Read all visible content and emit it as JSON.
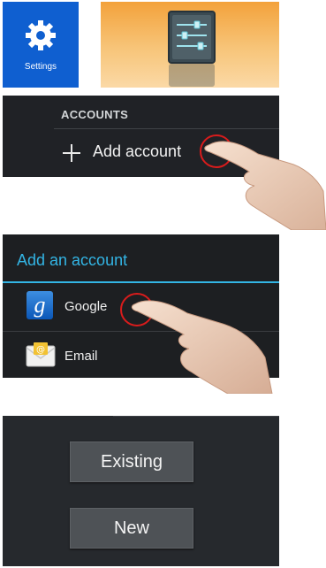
{
  "settings_tile": {
    "label": "Settings",
    "icon": "gear-icon",
    "color": "#0f5fd0"
  },
  "settings_app_icon": {
    "icon": "sliders-icon",
    "background": "#f3a23b"
  },
  "accounts_screen": {
    "section_header": "ACCOUNTS",
    "add_account_label": "Add account",
    "add_icon": "plus-icon"
  },
  "add_account_dialog": {
    "title": "Add an account",
    "title_color": "#33b5e5",
    "providers": [
      {
        "label": "Google",
        "icon": "google-icon"
      },
      {
        "label": "Email",
        "icon": "envelope-icon"
      }
    ]
  },
  "account_choice": {
    "existing_label": "Existing",
    "new_label": "New"
  },
  "annotations": {
    "tap_marker_color": "#d91c1c",
    "pointer": "hand-pointer-icon"
  }
}
